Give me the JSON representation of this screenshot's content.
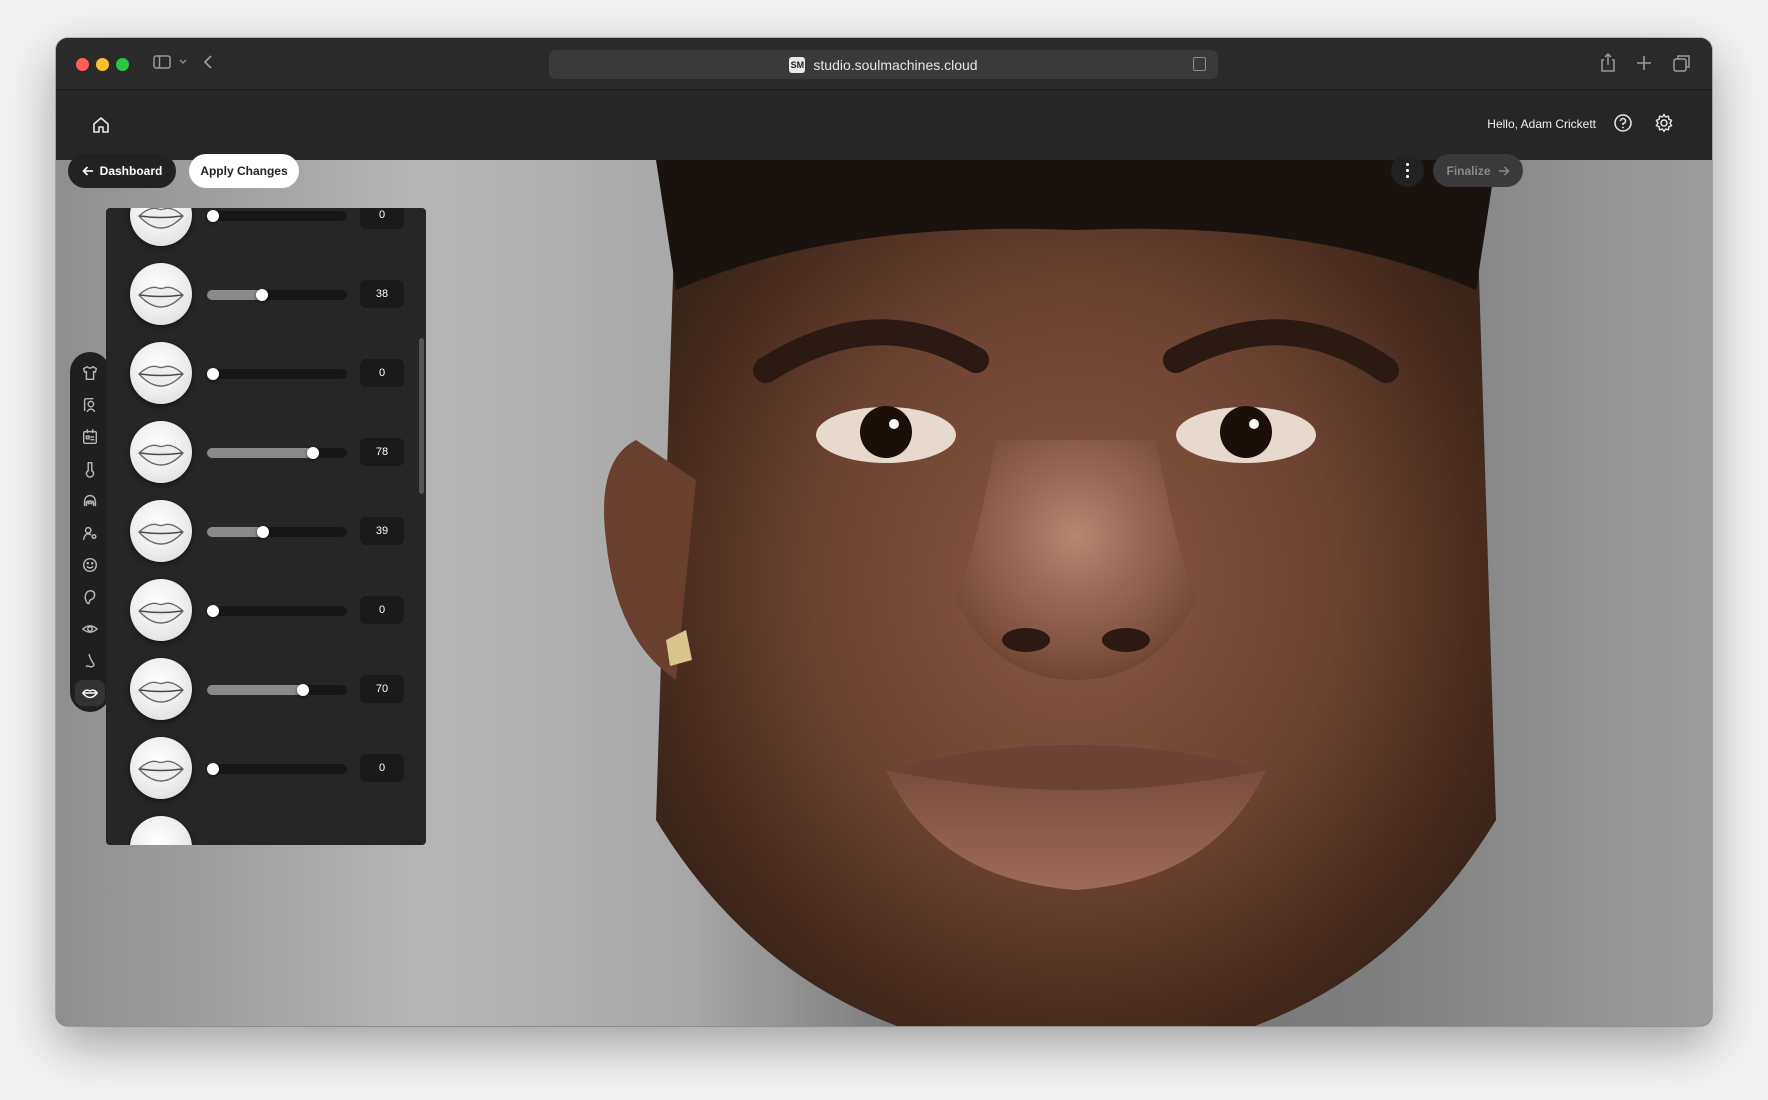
{
  "browser": {
    "url": "studio.soulmachines.cloud",
    "site_logo": "SM",
    "icons": [
      "sidebar-toggle-icon",
      "chevron-down-icon",
      "back-arrow-icon",
      "reader-icon",
      "share-icon",
      "new-tab-icon",
      "tab-overview-icon"
    ]
  },
  "header": {
    "greeting": "Hello, Adam Crickett",
    "icons": [
      "home-icon",
      "help-icon",
      "settings-icon"
    ]
  },
  "controls": {
    "dashboard_label": "Dashboard",
    "apply_label": "Apply Changes",
    "finalize_label": "Finalize"
  },
  "toolbar": {
    "items": [
      {
        "name": "clothing",
        "icon": "shirt-icon"
      },
      {
        "name": "head",
        "icon": "face-frame-icon"
      },
      {
        "name": "presets",
        "icon": "id-card-icon"
      },
      {
        "name": "skin",
        "icon": "skin-tone-icon"
      },
      {
        "name": "hair",
        "icon": "hair-icon"
      },
      {
        "name": "body",
        "icon": "person-settings-icon"
      },
      {
        "name": "expression",
        "icon": "smile-icon"
      },
      {
        "name": "ears",
        "icon": "ear-icon"
      },
      {
        "name": "eyes",
        "icon": "eye-icon"
      },
      {
        "name": "nose",
        "icon": "nose-icon"
      },
      {
        "name": "mouth",
        "icon": "lips-icon",
        "active": true
      }
    ]
  },
  "sliders": [
    {
      "value": 0,
      "display": "0"
    },
    {
      "value": 38,
      "display": "38"
    },
    {
      "value": 0,
      "display": "0"
    },
    {
      "value": 78,
      "display": "78"
    },
    {
      "value": 39,
      "display": "39"
    },
    {
      "value": 0,
      "display": "0"
    },
    {
      "value": 70,
      "display": "70"
    },
    {
      "value": 0,
      "display": "0"
    }
  ],
  "colors": {
    "chrome": "#2a2a2a",
    "header": "#262626",
    "panel": "#262626",
    "apply_button": "#ffffff",
    "finalize_disabled": "#3a3a3a"
  }
}
